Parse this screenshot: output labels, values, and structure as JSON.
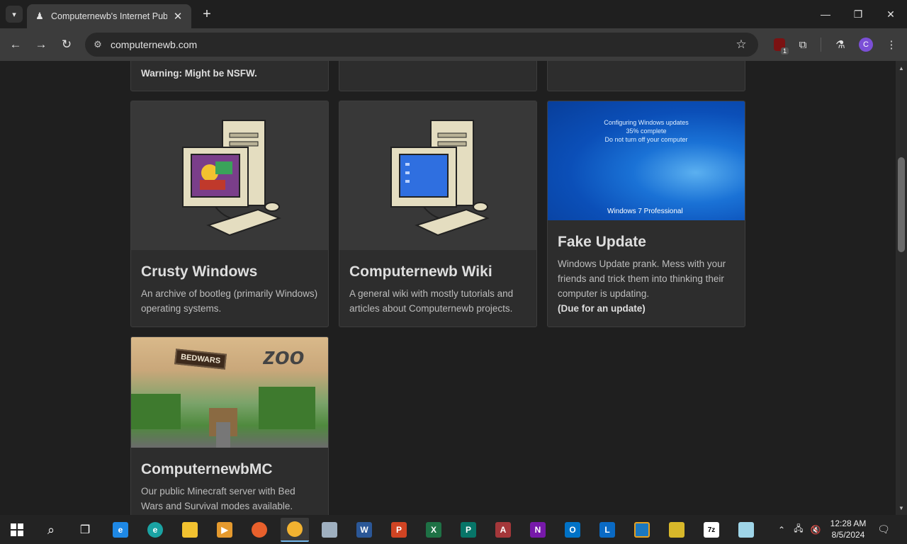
{
  "browser": {
    "tab_title": "Computernewb's Internet Pub",
    "url": "computernewb.com",
    "profile_initial": "C",
    "extension_badge": "1"
  },
  "cards_top_partial": {
    "first_note": "Warning: Might be NSFW."
  },
  "cards": [
    {
      "title": "Crusty Windows",
      "description": "An archive of bootleg (primarily Windows) operating systems.",
      "note": ""
    },
    {
      "title": "Computernewb Wiki",
      "description": "A general wiki with mostly tutorials and articles about Computernewb projects.",
      "note": ""
    },
    {
      "title": "Fake Update",
      "description": "Windows Update prank. Mess with your friends and trick them into thinking their computer is updating.",
      "note": "(Due for an update)",
      "image_text": [
        "Configuring Windows updates",
        "35% complete",
        "Do not turn off your computer"
      ],
      "image_logo": "Windows 7 Professional"
    },
    {
      "title": "ComputernewbMC",
      "description": "Our public Minecraft server with Bed Wars and Survival modes available.",
      "note": "",
      "image_sign": "BEDWARS",
      "image_word": "zoo"
    }
  ],
  "taskbar": {
    "apps": [
      "start-icon",
      "search-icon",
      "task-view-icon",
      "internet-explorer-icon",
      "edge-canary-icon",
      "file-explorer-icon",
      "media-player-icon",
      "firefox-icon",
      "chrome-canary-icon",
      "remote-desktop-icon",
      "word-icon",
      "powerpoint-icon",
      "excel-icon",
      "publisher-icon",
      "access-icon",
      "onenote-icon",
      "outlook-icon",
      "lync-icon",
      "virtualbox-icon",
      "winscp-icon",
      "7zip-icon",
      "notepad-icon"
    ],
    "time": "12:28 AM",
    "date": "8/5/2024"
  },
  "colors": {
    "page_bg": "#1f1f1f",
    "card_bg": "#2d2d2d",
    "chrome_toolbar": "#3c3c3c",
    "accent": "#7b4fd6"
  }
}
